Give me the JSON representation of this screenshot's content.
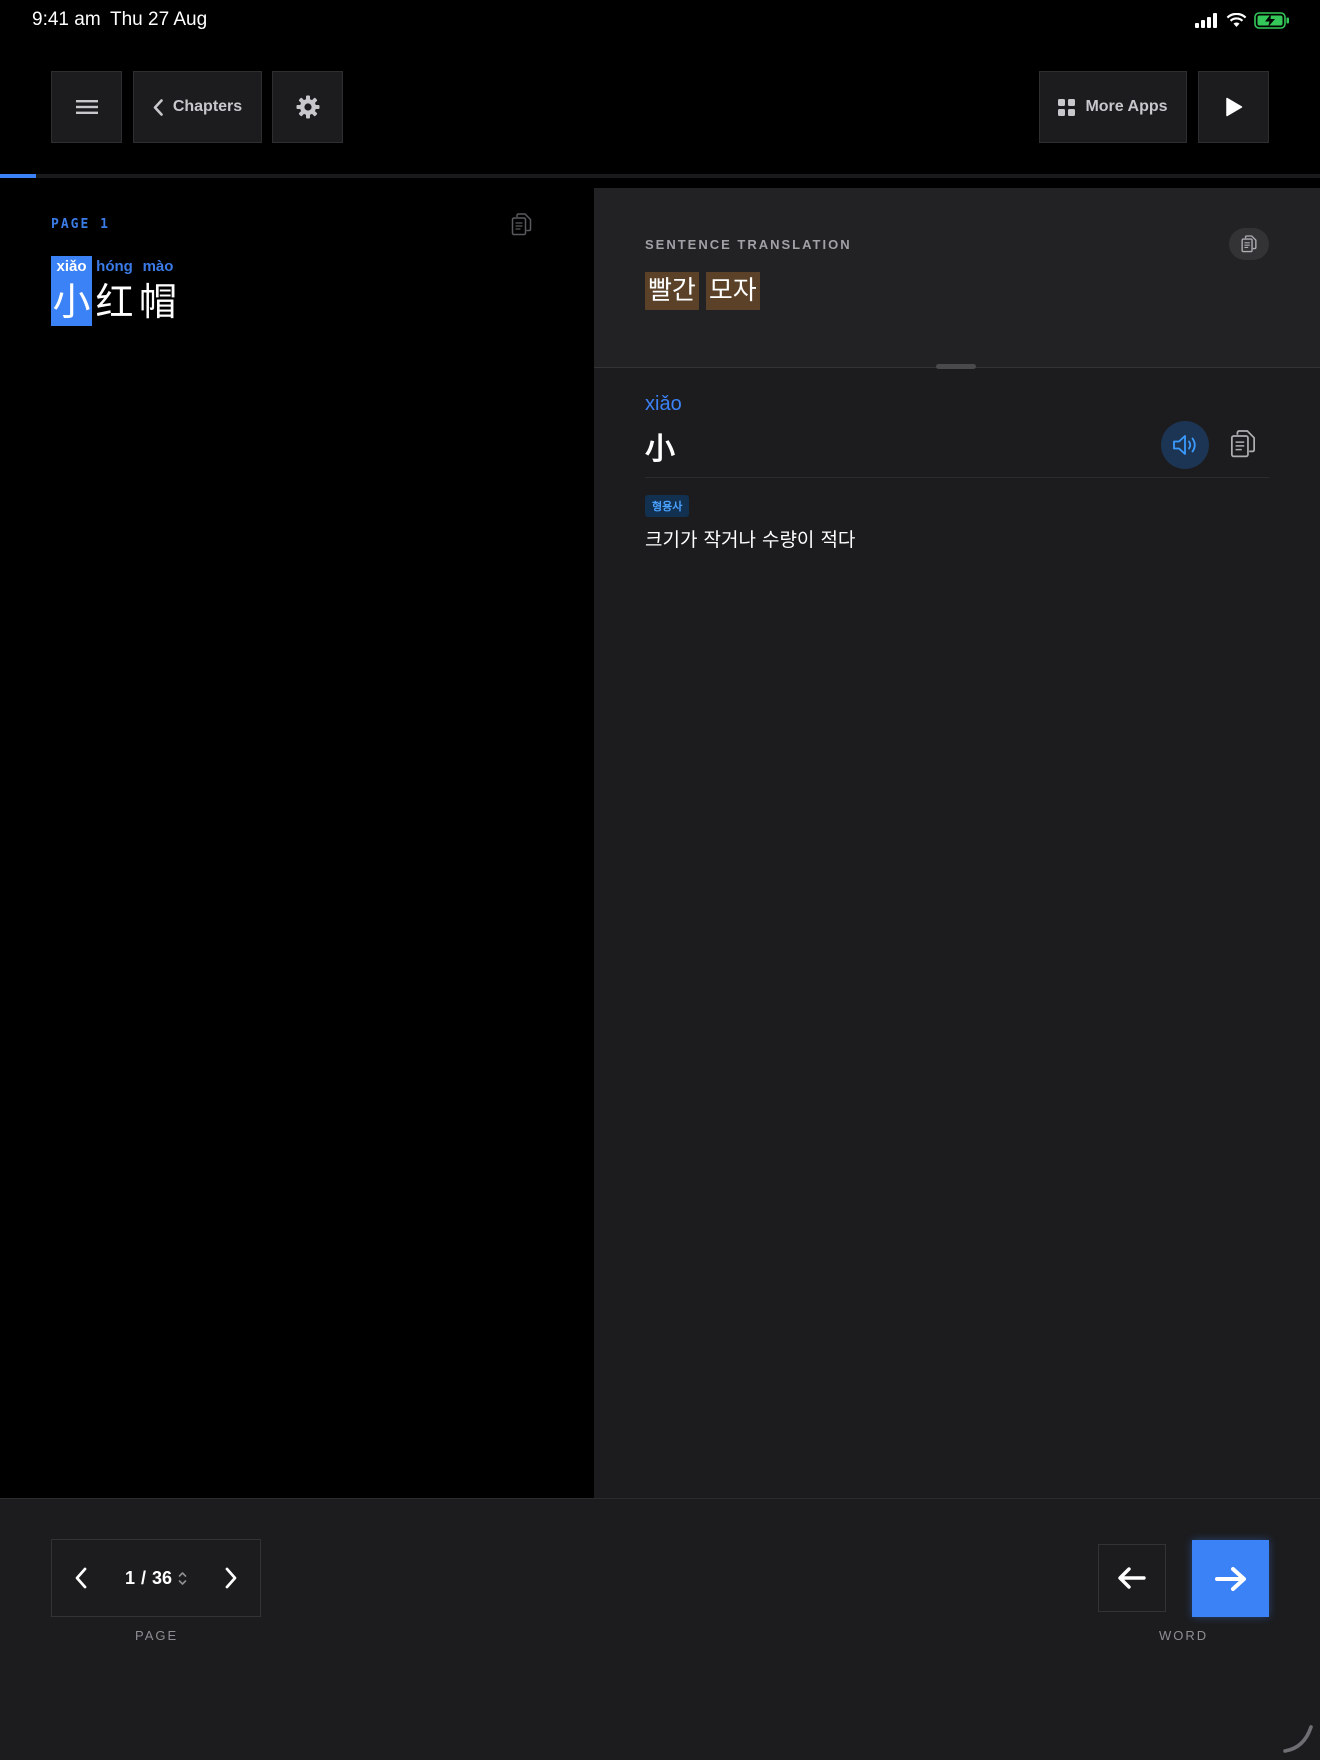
{
  "status_bar": {
    "time": "9:41 am",
    "date": "Thu 27 Aug",
    "icons": [
      "cellular-signal-icon",
      "wifi-icon",
      "battery-charging-icon"
    ]
  },
  "toolbar": {
    "menu_icon": "hamburger-menu-icon",
    "chapters_label": "Chapters",
    "settings_icon": "gear-icon",
    "more_apps_label": "More Apps",
    "play_icon": "play-icon"
  },
  "reading_progress": 0.027,
  "left_pane": {
    "page_label": "PAGE 1",
    "copy_icon": "copy-icon",
    "words": [
      {
        "pinyin": "xiǎo",
        "hanzi": "小",
        "active": true
      },
      {
        "pinyin": "hóng",
        "hanzi": "红",
        "active": false
      },
      {
        "pinyin": "mào",
        "hanzi": "帽",
        "active": false
      }
    ]
  },
  "translation": {
    "section_title": "SENTENCE TRANSLATION",
    "words": [
      "빨간",
      "모자"
    ]
  },
  "word_detail": {
    "pinyin": "xiǎo",
    "hanzi": "小",
    "part_of_speech": "형용사",
    "definition": "크기가 작거나 수량이 적다"
  },
  "pager": {
    "current": "1",
    "separator": "/",
    "total": "36",
    "label": "PAGE"
  },
  "word_nav": {
    "label": "WORD"
  },
  "colors": {
    "accent": "#3b82f6",
    "highlight": "#5a4128",
    "panel": "#1c1c1e"
  }
}
